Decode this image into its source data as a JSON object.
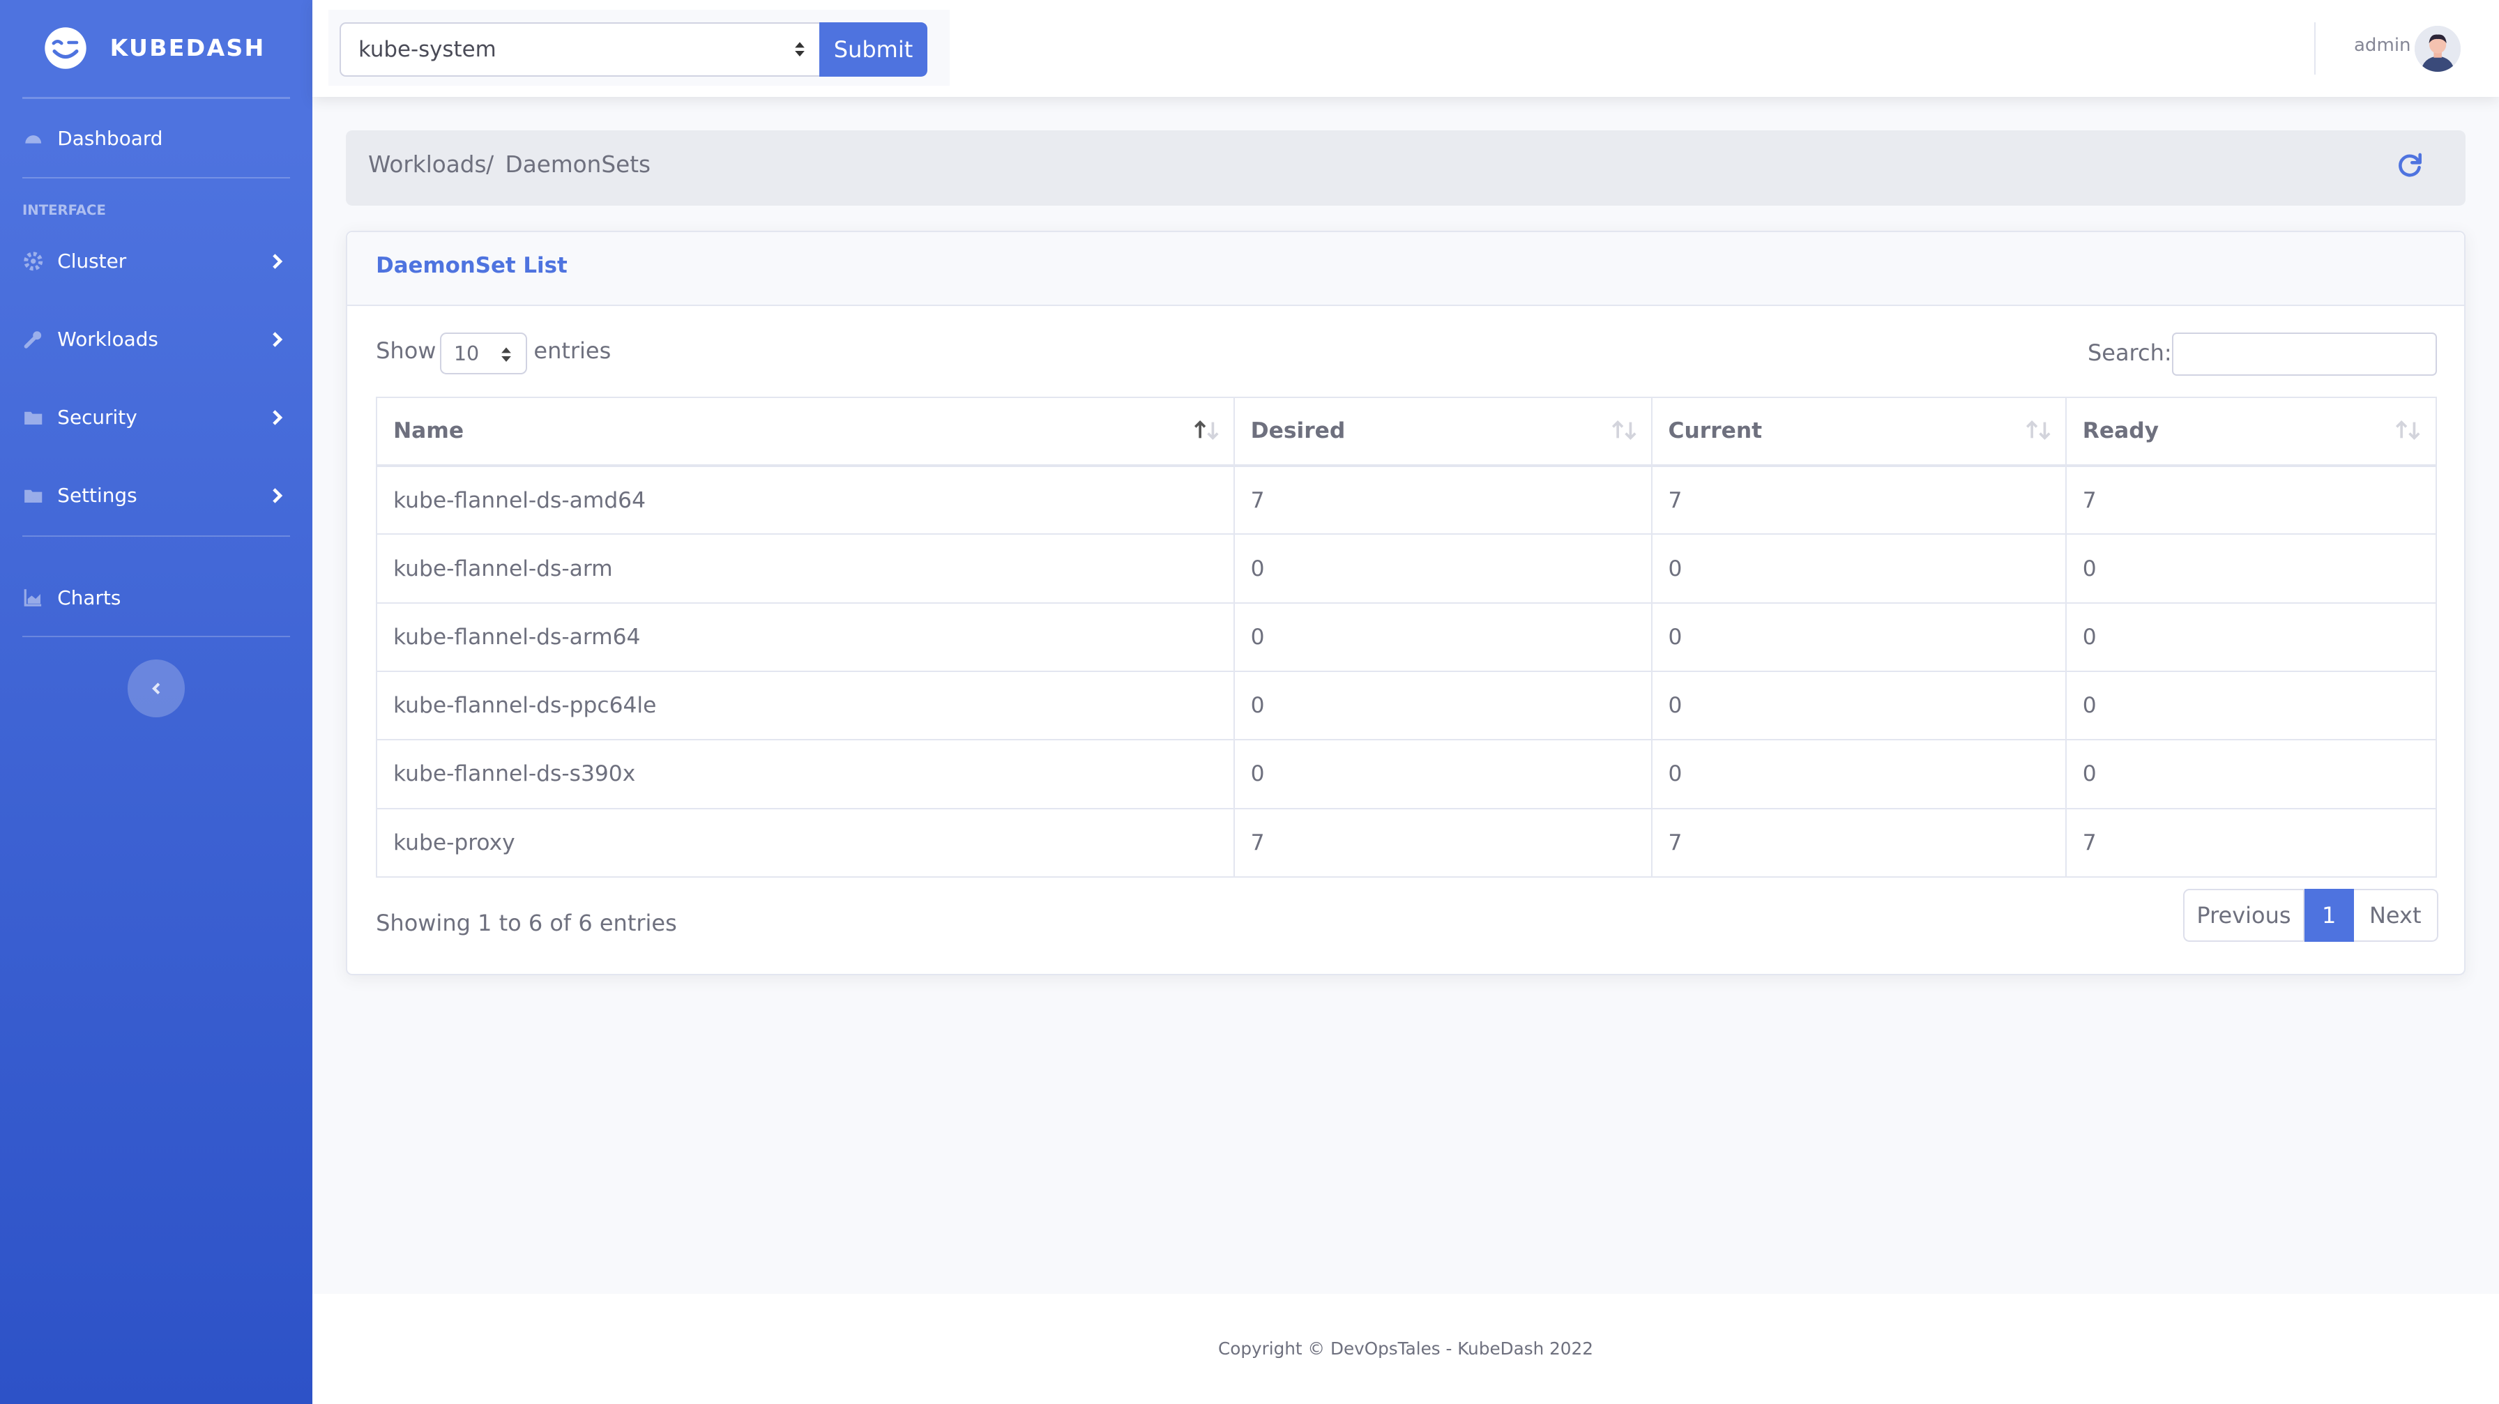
{
  "brand": {
    "name": "KUBEDASH",
    "logo_icon": "smile-wink-icon"
  },
  "sidebar": {
    "dashboard": {
      "label": "Dashboard",
      "icon": "tachometer-icon"
    },
    "heading": "INTERFACE",
    "items": [
      {
        "label": "Cluster",
        "icon": "gear-icon"
      },
      {
        "label": "Workloads",
        "icon": "wrench-icon"
      },
      {
        "label": "Security",
        "icon": "folder-icon"
      },
      {
        "label": "Settings",
        "icon": "folder-icon"
      }
    ],
    "charts": {
      "label": "Charts",
      "icon": "area-chart-icon"
    },
    "toggle_icon": "chevron-left-icon"
  },
  "topbar": {
    "namespace": "kube-system",
    "submit_label": "Submit",
    "user_name": "admin"
  },
  "breadcrumb": [
    "Workloads",
    "DaemonSets"
  ],
  "card": {
    "title": "DaemonSet List",
    "show_label": "Show",
    "page_length": "10",
    "entries_label": "entries",
    "search_label": "Search:",
    "search_value": ""
  },
  "table": {
    "columns": [
      "Name",
      "Desired",
      "Current",
      "Ready"
    ],
    "rows": [
      [
        "kube-flannel-ds-amd64",
        "7",
        "7",
        "7"
      ],
      [
        "kube-flannel-ds-arm",
        "0",
        "0",
        "0"
      ],
      [
        "kube-flannel-ds-arm64",
        "0",
        "0",
        "0"
      ],
      [
        "kube-flannel-ds-ppc64le",
        "0",
        "0",
        "0"
      ],
      [
        "kube-flannel-ds-s390x",
        "0",
        "0",
        "0"
      ],
      [
        "kube-proxy",
        "7",
        "7",
        "7"
      ]
    ]
  },
  "info": "Showing 1 to 6 of 6 entries",
  "pagination": {
    "previous": "Previous",
    "current": "1",
    "next": "Next"
  },
  "footer": "Copyright © DevOpsTales - KubeDash 2022",
  "colors": {
    "primary": "#4e73df",
    "sidebar_bottom": "#2d52c7",
    "text": "#6e707e"
  }
}
